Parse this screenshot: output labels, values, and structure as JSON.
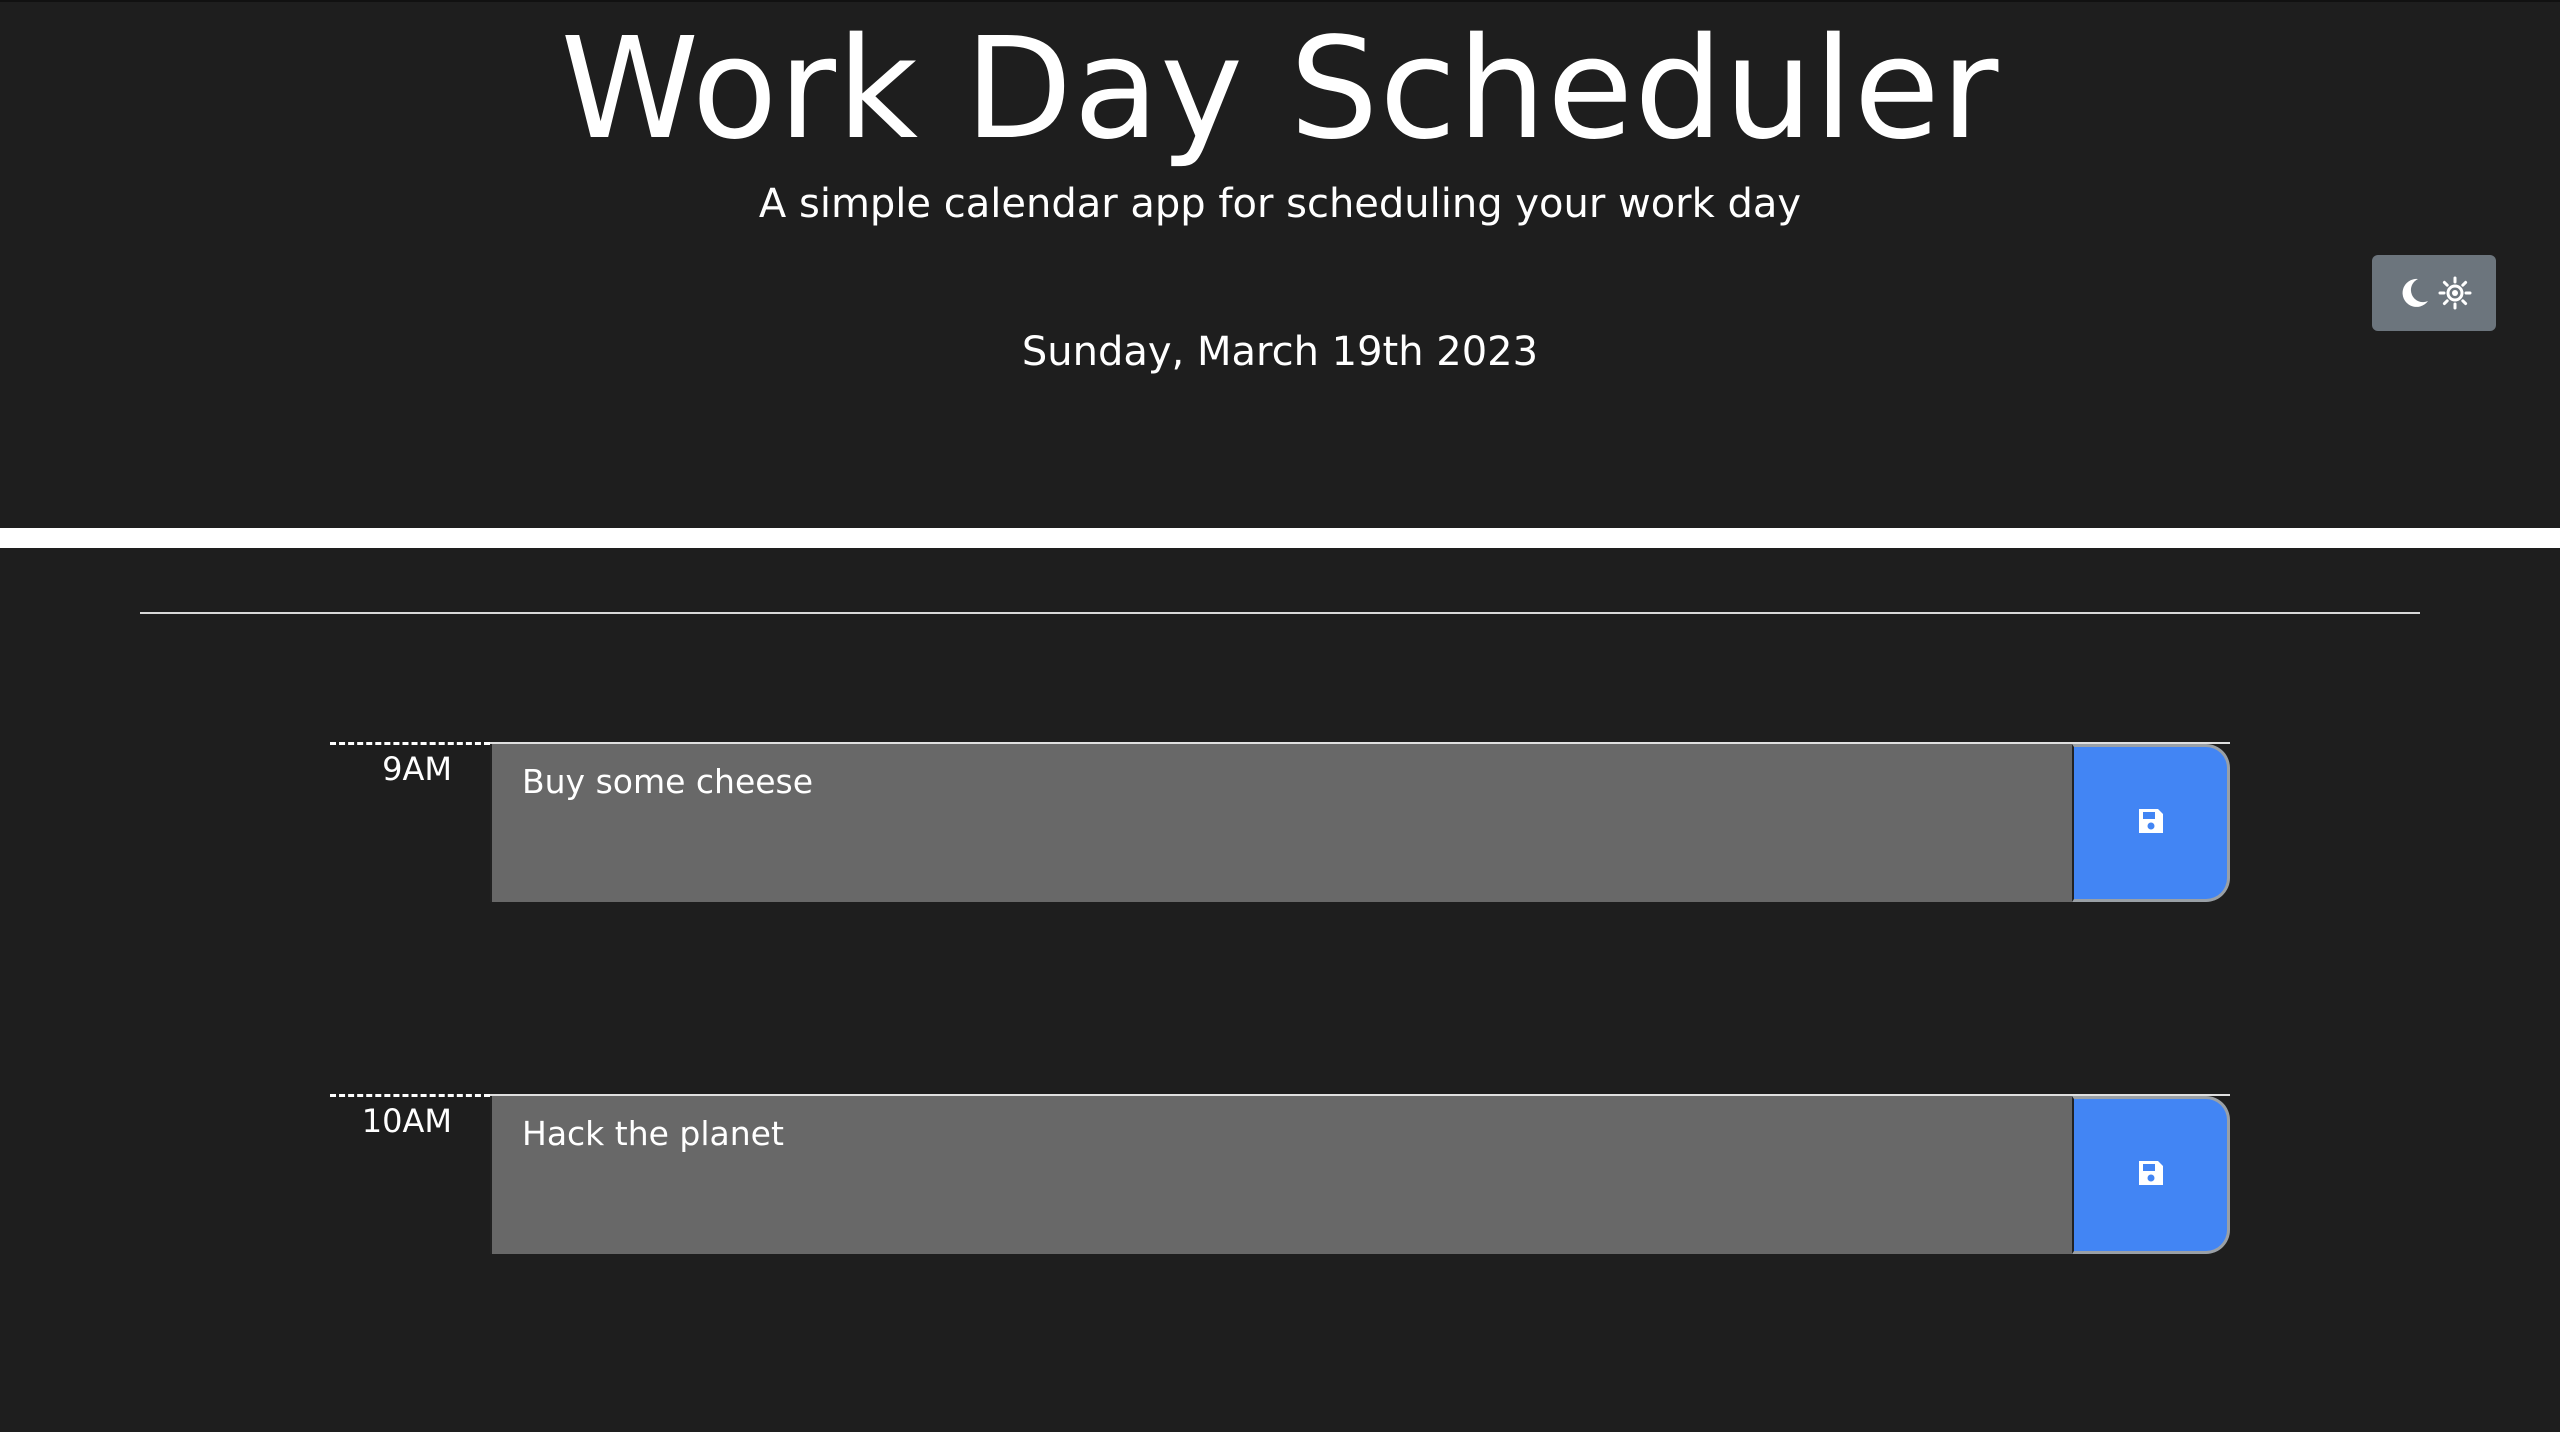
{
  "header": {
    "title": "Work Day Scheduler",
    "subtitle": "A simple calendar app for scheduling your work day",
    "current_day": "Sunday, March 19th 2023"
  },
  "theme_toggle": {
    "icons": [
      "moon-icon",
      "sun-icon"
    ]
  },
  "time_blocks": [
    {
      "hour": "9AM",
      "description": "Buy some cheese",
      "status": "past"
    },
    {
      "hour": "10AM",
      "description": "Hack the planet",
      "status": "past"
    }
  ],
  "colors": {
    "background": "#1e1e1e",
    "past_block": "#686868",
    "save_button": "#4285f4",
    "toggle_button": "#6c757d",
    "divider": "#ffffff"
  }
}
